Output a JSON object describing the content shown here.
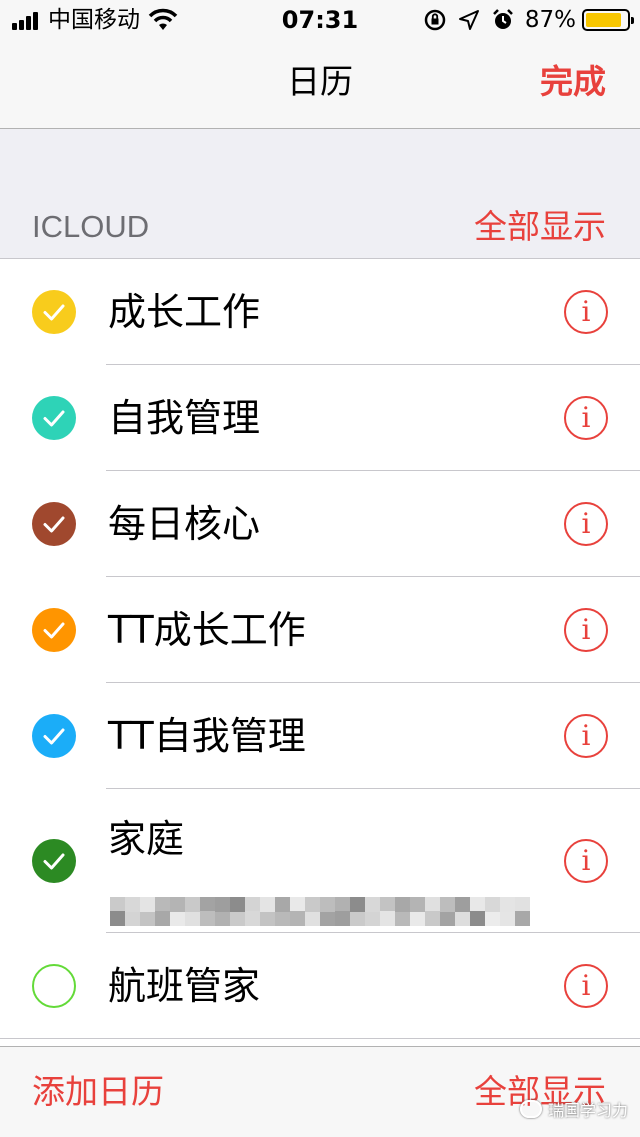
{
  "status_bar": {
    "carrier": "中国移动",
    "time": "07:31",
    "battery_percent": "87%",
    "battery_level": 0.87,
    "battery_color": "#f7c600"
  },
  "nav": {
    "title": "日历",
    "done_label": "完成"
  },
  "section": {
    "title": "ICLOUD",
    "show_all_label": "全部显示"
  },
  "calendars": [
    {
      "name": "成长工作",
      "color": "#f8cc1c",
      "checked": true
    },
    {
      "name": "自我管理",
      "color": "#2ed3b7",
      "checked": true
    },
    {
      "name": "每日核心",
      "color": "#a0482e",
      "checked": true
    },
    {
      "name": "TT成长工作",
      "color": "#ff9500",
      "checked": true
    },
    {
      "name": "TT自我管理",
      "color": "#1badf8",
      "checked": true
    },
    {
      "name": "家庭",
      "color": "#2c8a23",
      "checked": true
    },
    {
      "name": "航班管家",
      "color": "#63da38",
      "checked": false
    }
  ],
  "toolbar": {
    "add_label": "添加日历",
    "show_all_label": "全部显示"
  },
  "watermark": {
    "text": "瑞国学习力"
  },
  "theme": {
    "accent": "#e8413c",
    "separator": "#c8c7cc",
    "grouped_background": "#efeff4"
  }
}
